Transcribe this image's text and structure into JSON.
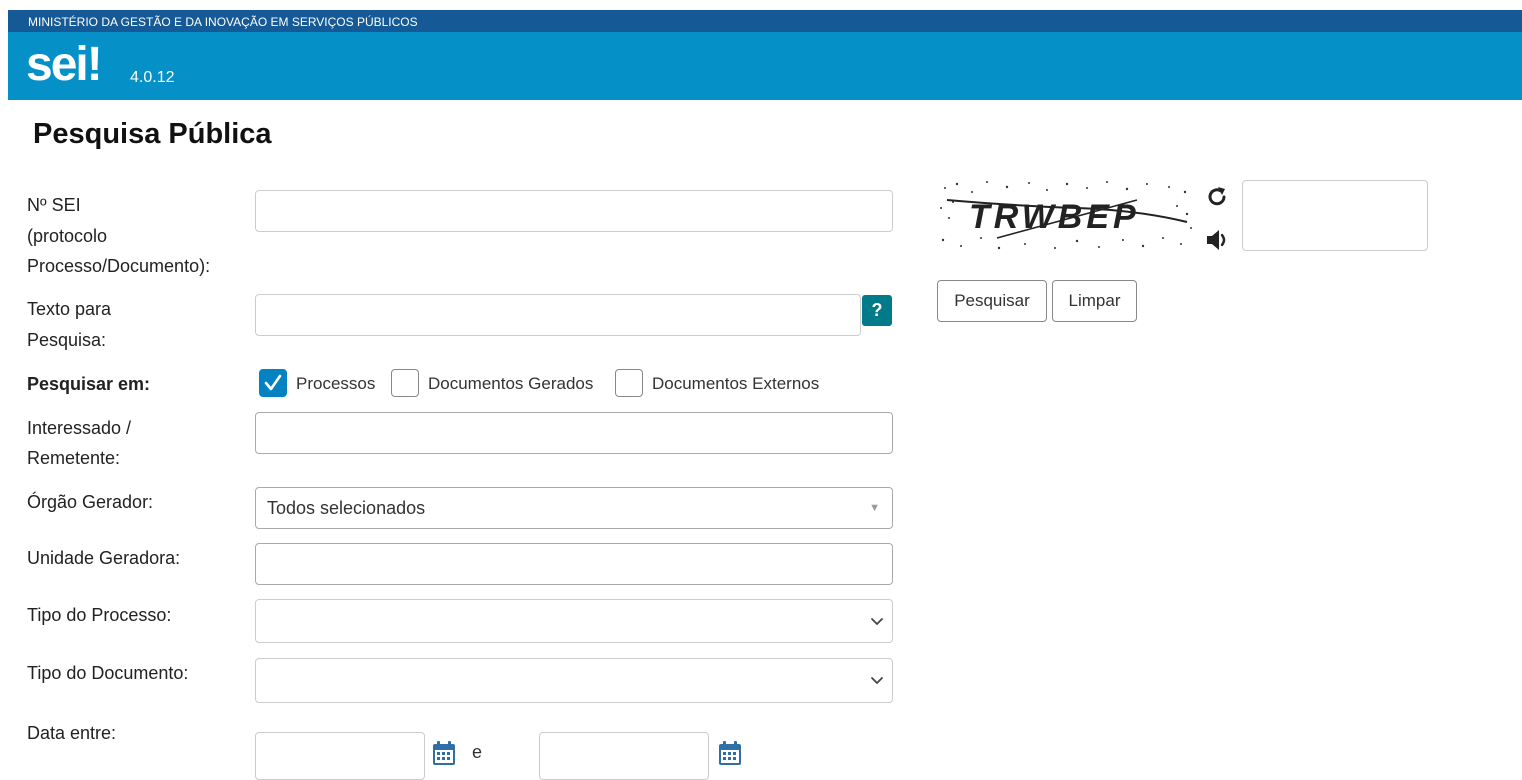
{
  "header": {
    "ministry": "MINISTÉRIO DA GESTÃO E DA INOVAÇÃO EM SERVIÇOS PÚBLICOS",
    "logo": "sei!",
    "version": "4.0.12"
  },
  "page": {
    "title": "Pesquisa Pública"
  },
  "form": {
    "sei_label_1": "Nº SEI",
    "sei_label_2": "(protocolo",
    "sei_label_3": "Processo/Documento):",
    "sei_value": "",
    "texto_label_1": "Texto para",
    "texto_label_2": "Pesquisa:",
    "texto_value": "",
    "help_label": "?",
    "pesquisar_em_label": "Pesquisar em:",
    "checkboxes": [
      {
        "label": "Processos",
        "checked": true
      },
      {
        "label": "Documentos Gerados",
        "checked": false
      },
      {
        "label": "Documentos Externos",
        "checked": false
      }
    ],
    "interessado_label_1": "Interessado /",
    "interessado_label_2": "Remetente:",
    "interessado_value": "",
    "orgao_label": "Órgão Gerador:",
    "orgao_value": "Todos selecionados",
    "unidade_label": "Unidade Geradora:",
    "unidade_value": "",
    "tipo_processo_label": "Tipo do Processo:",
    "tipo_processo_value": "",
    "tipo_documento_label": "Tipo do Documento:",
    "tipo_documento_value": "",
    "data_label": "Data entre:",
    "data_and": "e",
    "data_start": "",
    "data_end": ""
  },
  "captcha": {
    "text": "TRWBEP",
    "input_value": "",
    "refresh_icon": "refresh-icon",
    "audio_icon": "speaker-icon"
  },
  "buttons": {
    "search": "Pesquisar",
    "clear": "Limpar"
  },
  "colors": {
    "topbar": "#155a96",
    "brandbar": "#0591c8",
    "help": "#017a8a",
    "checkbox": "#0582c2"
  }
}
